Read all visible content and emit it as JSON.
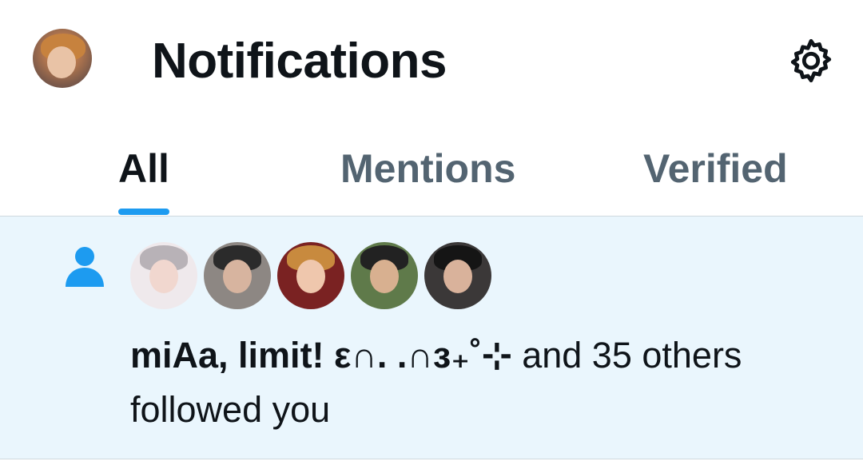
{
  "header": {
    "title": "Notifications",
    "avatar_icon": "user-avatar",
    "settings_icon": "gear-icon"
  },
  "tabs": [
    {
      "label": "All",
      "active": true
    },
    {
      "label": "Mentions",
      "active": false
    },
    {
      "label": "Verified",
      "active": false
    }
  ],
  "notification": {
    "type_icon": "person-icon",
    "names": "miAa, limit! ε∩. .∩з₊˚⊹",
    "rest": " and 35 others followed you",
    "avatar_count": 5
  },
  "colors": {
    "accent": "#1d9bf0",
    "highlight_bg": "#eaf6fd",
    "text_primary": "#0f1419",
    "text_secondary": "#536471"
  }
}
